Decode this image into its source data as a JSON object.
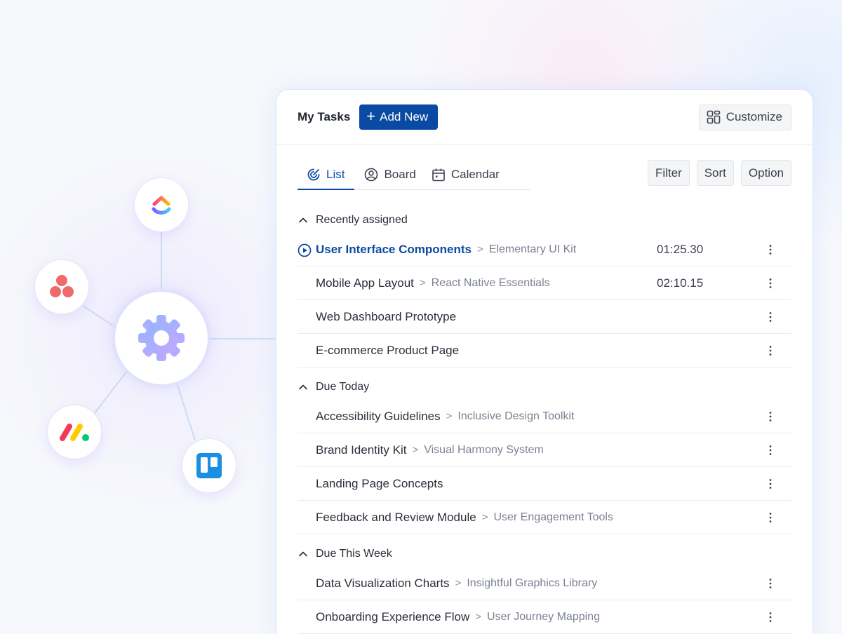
{
  "header": {
    "title": "My Tasks",
    "add_label": "Add New",
    "customize_label": "Customize"
  },
  "tabs": [
    {
      "label": "List",
      "icon": "target-icon",
      "active": true
    },
    {
      "label": "Board",
      "icon": "user-circle-icon",
      "active": false
    },
    {
      "label": "Calendar",
      "icon": "calendar-icon",
      "active": false
    }
  ],
  "toolbar": {
    "filter_label": "Filter",
    "sort_label": "Sort",
    "option_label": "Option"
  },
  "groups": [
    {
      "title": "Recently assigned",
      "tasks": [
        {
          "name": "User Interface Components",
          "project": "Elementary UI Kit",
          "time": "01:25.30",
          "playing": true
        },
        {
          "name": "Mobile App Layout",
          "project": "React Native Essentials",
          "time": "02:10.15"
        },
        {
          "name": "Web Dashboard Prototype"
        },
        {
          "name": "E-commerce Product Page"
        }
      ]
    },
    {
      "title": "Due Today",
      "tasks": [
        {
          "name": "Accessibility Guidelines",
          "project": "Inclusive Design Toolkit"
        },
        {
          "name": "Brand Identity Kit",
          "project": "Visual Harmony System"
        },
        {
          "name": "Landing Page Concepts"
        },
        {
          "name": "Feedback and Review Module",
          "project": "User Engagement Tools"
        }
      ]
    },
    {
      "title": "Due This Week",
      "tasks": [
        {
          "name": "Data Visualization Charts",
          "project": "Insightful Graphics Library"
        },
        {
          "name": "Onboarding Experience Flow",
          "project": "User Journey Mapping"
        }
      ]
    }
  ],
  "separator": ">",
  "integrations": [
    "clickup-logo",
    "asana-logo",
    "monday-logo",
    "trello-logo",
    "settings-gear-icon"
  ],
  "colors": {
    "accent": "#0b4aa2",
    "asana": "#f06a6a",
    "trello": "#1d8fe3",
    "monday_red": "#f3385a",
    "monday_yellow": "#ffcb00",
    "monday_green": "#00ca72"
  }
}
